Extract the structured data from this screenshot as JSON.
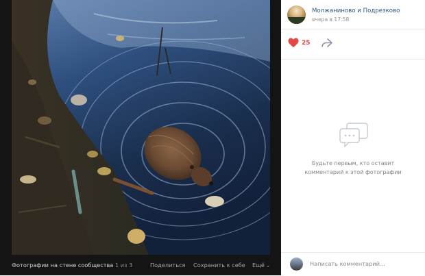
{
  "viewer": {
    "album_label": "Фотографии на стене сообщества",
    "counter": "1 из 3",
    "share_label": "Поделиться",
    "save_label": "Сохранить к себе",
    "more_label": "Ещё"
  },
  "post": {
    "group_name": "Молжаниново и Подрезково",
    "time": "вчера в 17:58",
    "like_count": "25"
  },
  "comments": {
    "empty_text": "Будьте первым, кто оставит комментарий к этой фотографии",
    "input_placeholder": "Написать комментарий..."
  },
  "colors": {
    "like": "#e64646",
    "link": "#2a5885",
    "viewer_bg": "#141414"
  },
  "icons": {
    "like": "heart-icon",
    "share": "share-arrow-icon",
    "empty_comments": "speech-bubble-icon",
    "more": "chevron-down-icon"
  }
}
